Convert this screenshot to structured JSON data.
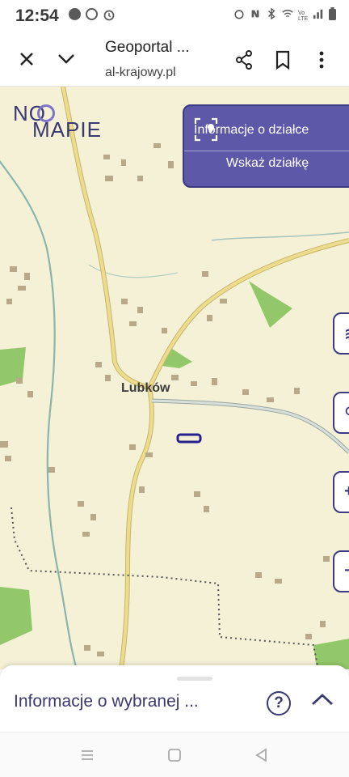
{
  "status_bar": {
    "time": "12:54",
    "left_icons": [
      "notification-app-icon",
      "notification-ring-icon",
      "alarm-icon"
    ],
    "right_icons": [
      "alarm-icon",
      "nfc-icon",
      "bluetooth-icon",
      "wifi-icon",
      "volte-icon",
      "signal-icon",
      "battery-icon"
    ],
    "volte_label": "Vo LTE"
  },
  "app_bar": {
    "title": "Geoportal ...",
    "url": "al-krajowy.pl",
    "icons": [
      "close-icon",
      "chevron-down-icon",
      "share-icon",
      "bookmark-icon",
      "more-vert-icon"
    ]
  },
  "map": {
    "logo_line1": "NO",
    "logo_line2": "MAPIE",
    "place_label": "Lubków",
    "parcel_panel": {
      "info_label": "Informacje o działce",
      "select_label": "Wskaż działkę"
    },
    "side_buttons": [
      {
        "icon": "layers-icon",
        "glyph": "≋"
      },
      {
        "icon": "person-icon",
        "glyph": "⚲"
      },
      {
        "icon": "zoom-in-icon",
        "glyph": "+"
      },
      {
        "icon": "zoom-out-icon",
        "glyph": "−"
      }
    ],
    "colors": {
      "background": "#f4f1d7",
      "road": "#e9d98a",
      "road_edge": "#c9b56a",
      "river": "#8ab5ad",
      "forest": "#93c86a",
      "building": "#b8a98a",
      "boundary": "#555555",
      "accent": "#3d3a82"
    }
  },
  "bottom_sheet": {
    "title": "Informacje o wybranej ...",
    "help_glyph": "?",
    "icons": [
      "help-icon",
      "chevron-up-icon"
    ]
  },
  "nav_bar": {
    "icons": [
      "recent-apps-icon",
      "home-icon",
      "back-icon"
    ]
  }
}
